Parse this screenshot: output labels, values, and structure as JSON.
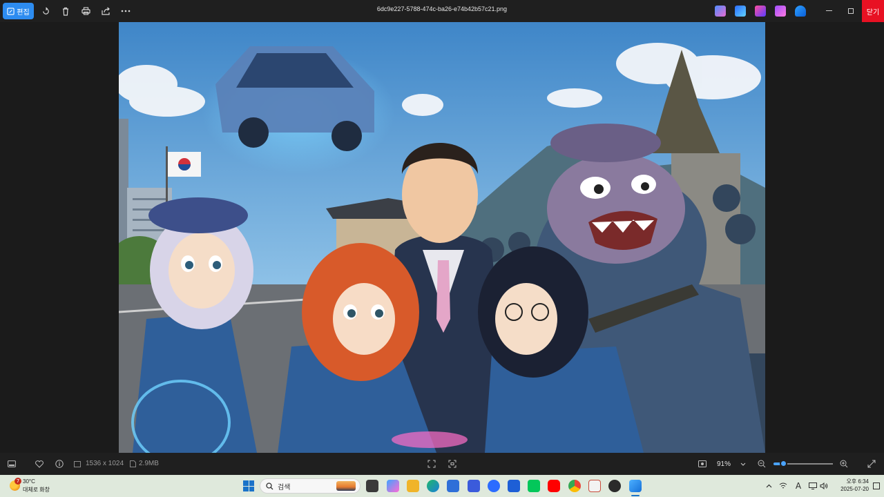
{
  "toolbar": {
    "edit_label": "편집",
    "icons": [
      "rotate-icon",
      "delete-icon",
      "print-icon",
      "share-icon",
      "more-icon"
    ],
    "filename": "6dc9e227-5788-474c-ba26-e74b42b57c21.png",
    "close_label": "닫기"
  },
  "colors": {
    "accent": "#2d8cf0",
    "close": "#e81123",
    "taskbar": "#dfe9dc"
  },
  "image": {
    "description_hidden": true
  },
  "status": {
    "dimensions": "1536 x 1024",
    "file_size": "2.9MB",
    "zoom": "91%",
    "zoom_fraction": 0.16
  },
  "taskbar": {
    "weather_badge": "7",
    "temperature": "30°C",
    "weather_desc": "대체로 화창",
    "search_placeholder": "검색",
    "time": "오후 6:34",
    "date": "2025-07-20",
    "ime": "A"
  }
}
